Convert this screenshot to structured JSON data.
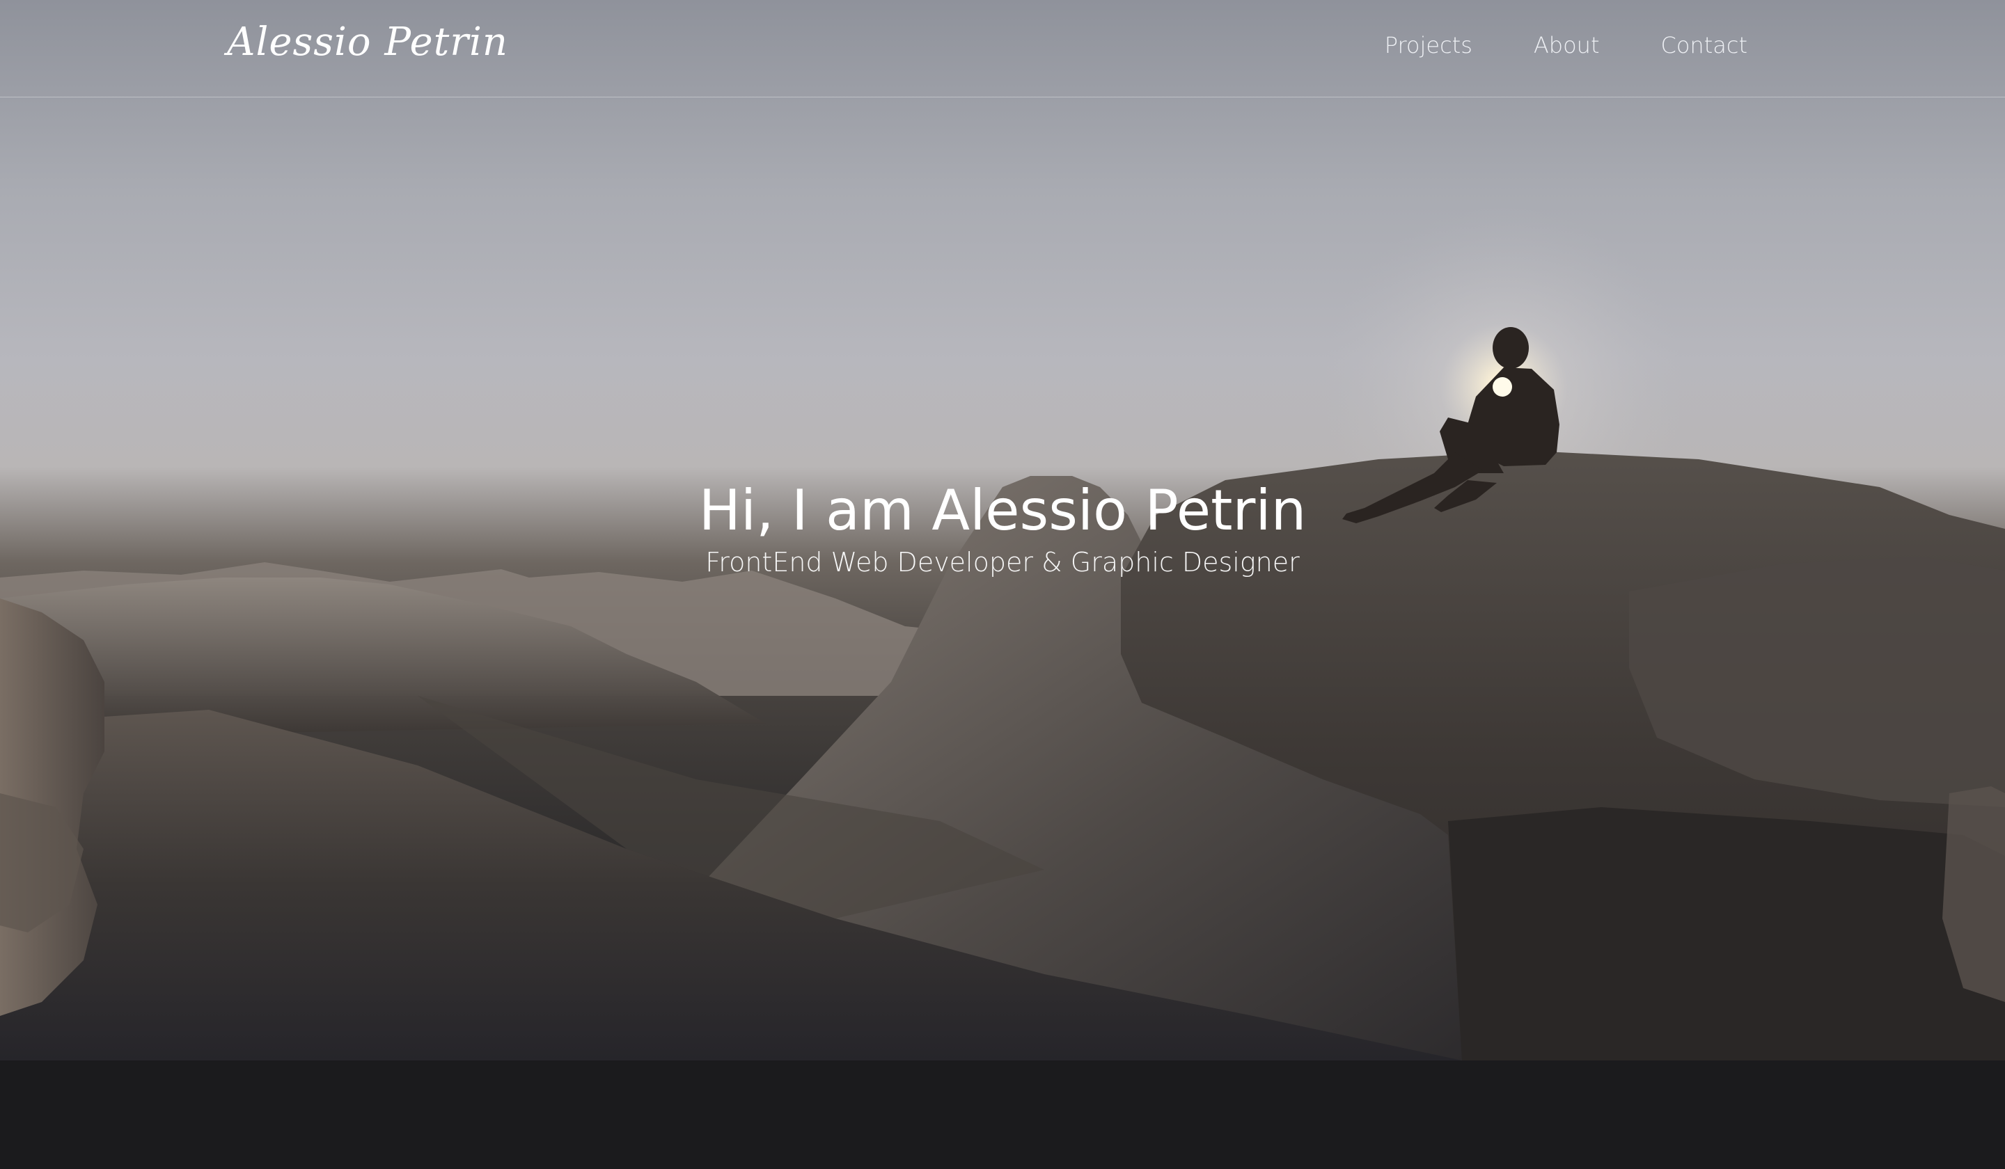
{
  "brand": {
    "name": "Alessio Petrin"
  },
  "nav": {
    "items": [
      {
        "label": "Projects"
      },
      {
        "label": "About"
      },
      {
        "label": "Contact"
      }
    ]
  },
  "hero": {
    "title": "Hi, I am Alessio Petrin",
    "subtitle": "FrontEnd Web Developer & Graphic Designer",
    "background": "mountain-cliff-photo"
  },
  "colors": {
    "sky_top": "#8f929b",
    "sky_horizon": "#b9b6b6",
    "rock": "#3a3532",
    "footer": "#1b1b1d",
    "text": "#ffffff"
  }
}
